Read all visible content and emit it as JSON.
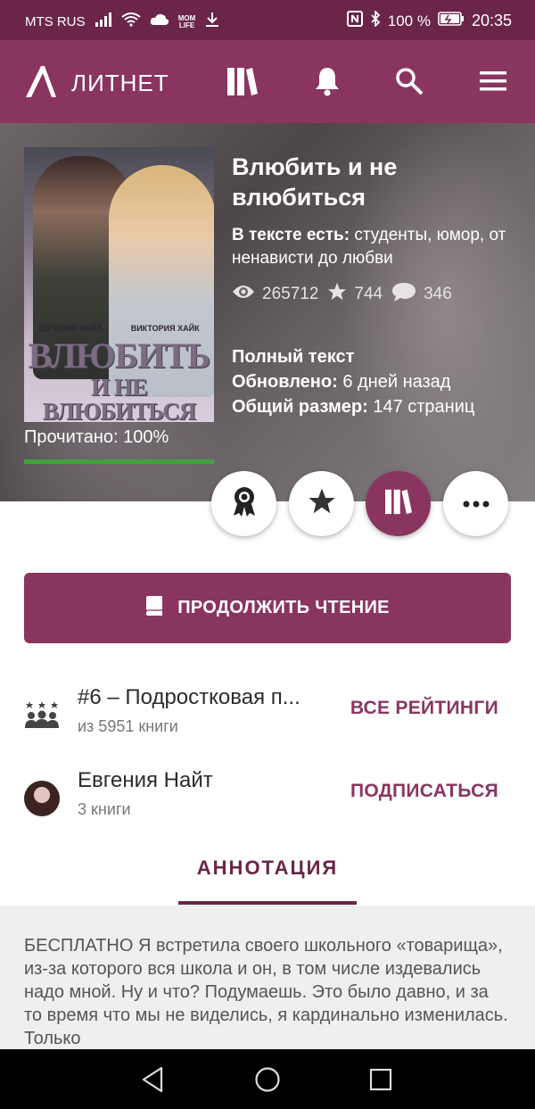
{
  "status_bar": {
    "carrier": "MTS RUS",
    "badge": "MOM LIFE",
    "battery": "100 %",
    "time": "20:35"
  },
  "app_bar": {
    "logo_text": "ЛИТНЕТ",
    "icons": [
      "library-icon",
      "bell-icon",
      "search-icon",
      "menu-icon"
    ]
  },
  "book": {
    "cover": {
      "authors": [
        "ЕВГЕНИЯ НАЙТ",
        "ВИКТОРИЯ ХАЙК"
      ],
      "title_line1": "ВЛЮБИТЬ",
      "title_line2": "И НЕ ВЛЮБИТЬСЯ"
    },
    "read_label": "Прочитано: 100%",
    "read_progress": 1.0,
    "title": "Влюбить и не влюбиться",
    "tags_label": "В тексте есть:",
    "tags_value": " студенты, юмор, от ненависти до любви",
    "views": "265712",
    "likes": "744",
    "comments": "346",
    "status": "Полный текст",
    "updated_label": "Обновлено:",
    "updated_value": " 6 дней назад",
    "size_label": "Общий размер:",
    "size_value": " 147 страниц"
  },
  "actions": [
    "award-icon",
    "star-icon",
    "library-icon",
    "more-icon"
  ],
  "continue_button": "ПРОДОЛЖИТЬ ЧТЕНИЕ",
  "rating_row": {
    "title": "#6 – Подростковая п...",
    "subtitle": "из 5951 книги",
    "action": "ВСЕ РЕЙТИНГИ"
  },
  "author_row": {
    "name": "Евгения Найт",
    "subtitle": "3 книги",
    "action": "ПОДПИСАТЬСЯ"
  },
  "tab": {
    "label": "АННОТАЦИЯ"
  },
  "annotation": {
    "text": "БЕСПЛАТНО Я встретила своего школьного «товарища», из-за которого вся школа и он, в том числе издевались надо мной. Ну и что? Подумаешь. Это было давно, и за то время что мы не виделись, я кардинально изменилась. Только"
  },
  "colors": {
    "status_bar": "#6a2548",
    "app_bar": "#8a3560",
    "accent": "#8a3560",
    "progress": "#3fa33a"
  }
}
